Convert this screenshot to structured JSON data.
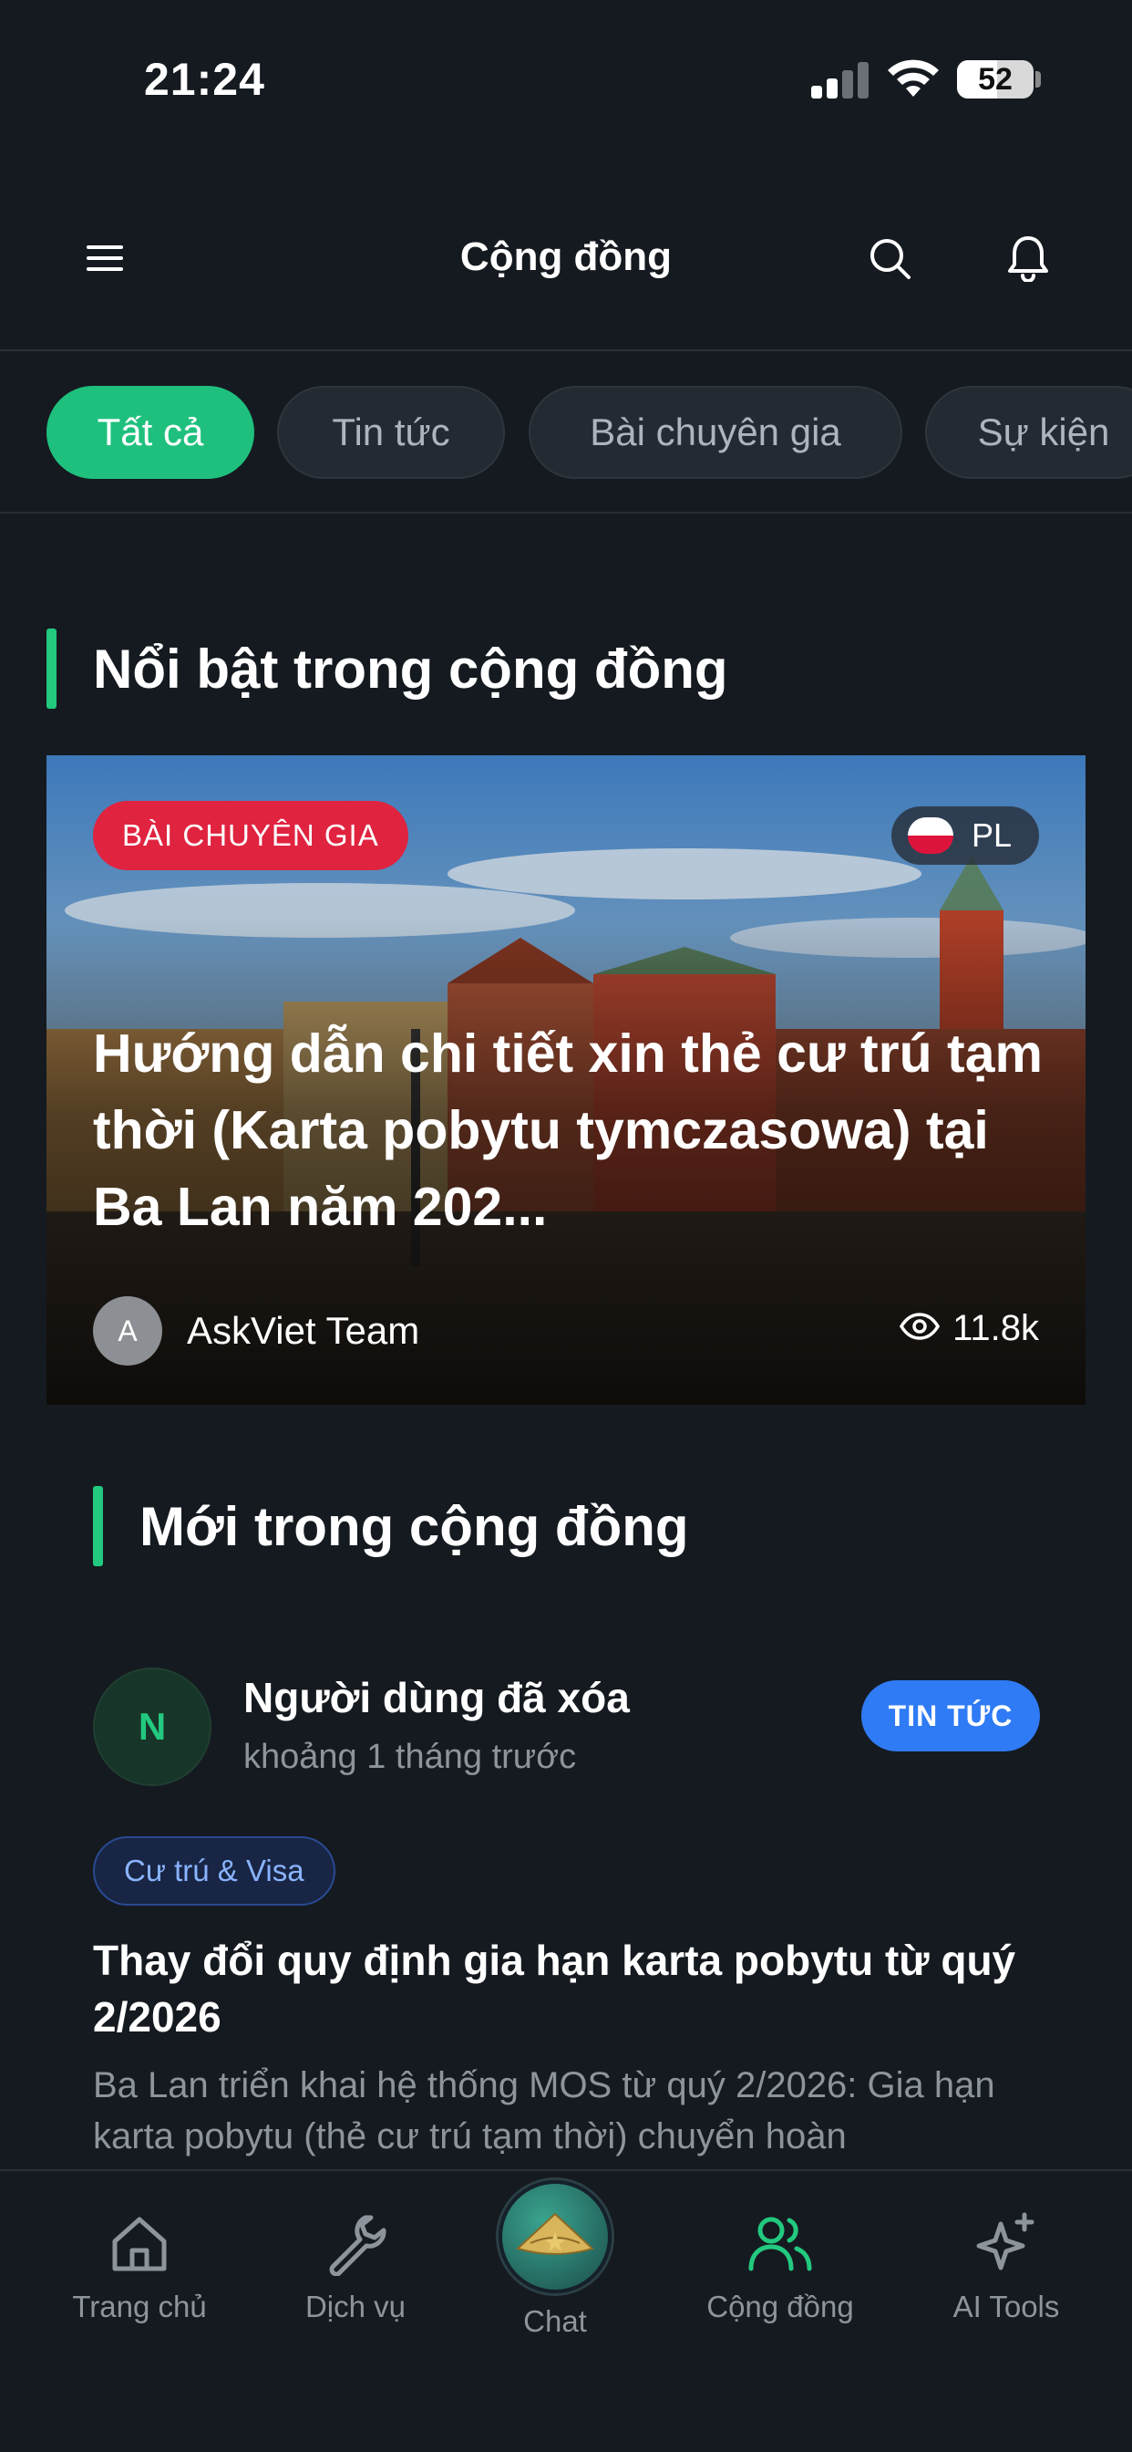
{
  "status_bar": {
    "time": "21:24",
    "battery": "52",
    "battery_level": 0.52
  },
  "header": {
    "title": "Cộng đồng"
  },
  "tabs": [
    {
      "label": "Tất cả",
      "active": true
    },
    {
      "label": "Tin tức",
      "active": false
    },
    {
      "label": "Bài chuyên gia",
      "active": false
    },
    {
      "label": "Sự kiện",
      "active": false
    }
  ],
  "featured_section": {
    "title": "Nổi bật trong cộng đồng",
    "card": {
      "category_badge": "BÀI CHUYÊN GIA",
      "country_code": "PL",
      "headline": "Hướng dẫn chi tiết xin thẻ cư trú tạm thời (Karta pobytu tymczasowa) tại Ba Lan năm 202...",
      "author_initial": "A",
      "author_name": "AskViet Team",
      "views": "11.8k"
    }
  },
  "new_section": {
    "title": "Mới trong cộng đồng",
    "post": {
      "avatar_initial": "N",
      "user": "Người dùng đã xóa",
      "time": "khoảng 1 tháng trước",
      "badge": "TIN TỨC",
      "tag": "Cư trú & Visa",
      "title": "Thay đổi quy định gia hạn karta pobytu từ quý 2/2026",
      "excerpt": "Ba Lan triển khai hệ thống MOS từ quý 2/2026: Gia hạn karta pobytu (thẻ cư trú tạm thời) chuyển hoàn"
    }
  },
  "bottom_nav": [
    {
      "label": "Trang chủ",
      "icon": "home-icon",
      "active": false
    },
    {
      "label": "Dịch vụ",
      "icon": "wrench-icon",
      "active": false
    },
    {
      "label": "Chat",
      "icon": "chat-hat-icon",
      "active": false
    },
    {
      "label": "Cộng đồng",
      "icon": "users-icon",
      "active": true
    },
    {
      "label": "AI Tools",
      "icon": "sparkles-icon",
      "active": false
    }
  ],
  "colors": {
    "background": "#151a20",
    "accent": "#22c97f",
    "expert_badge": "#e0233f",
    "news_badge": "#2f7bf5"
  }
}
